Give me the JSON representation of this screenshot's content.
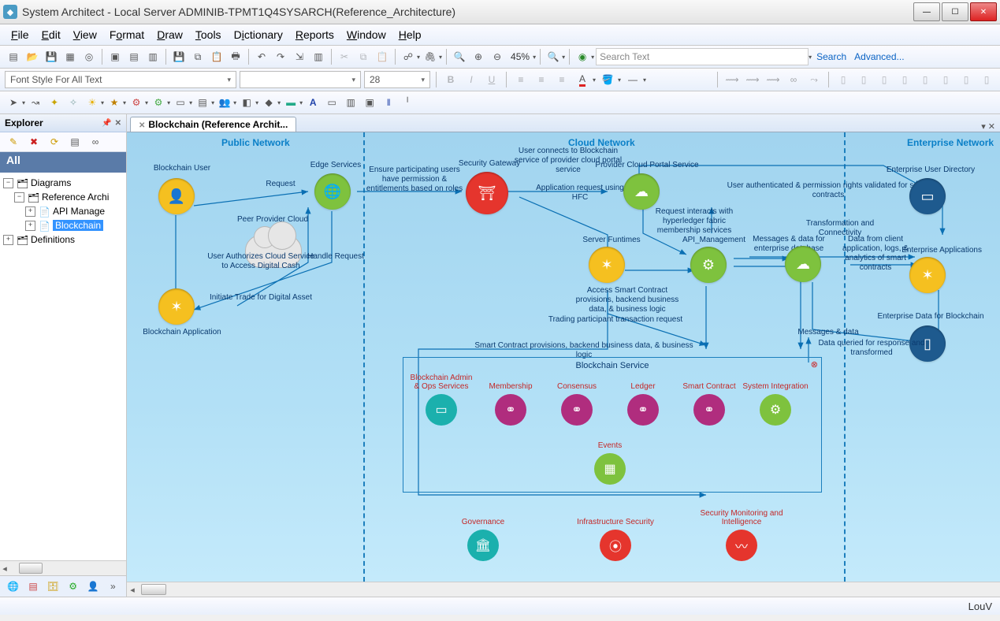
{
  "window": {
    "title": "System Architect - Local Server ADMINIB-TPMT1Q4SYSARCH(Reference_Architecture)"
  },
  "menubar": [
    "File",
    "Edit",
    "View",
    "Format",
    "Draw",
    "Tools",
    "Dictionary",
    "Reports",
    "Window",
    "Help"
  ],
  "toolbar": {
    "zoom": "45%",
    "search_placeholder": "Search Text",
    "search_link": "Search",
    "advanced_link": "Advanced..."
  },
  "format": {
    "font_style": "Font Style For All Text",
    "font_name": "",
    "font_size": "28"
  },
  "explorer": {
    "title": "Explorer",
    "all_label": "All",
    "nodes": {
      "diagrams": "Diagrams",
      "ref_arch": "Reference Archi",
      "api": "API Manage",
      "blockchain": "Blockchain",
      "definitions": "Definitions"
    }
  },
  "tab": {
    "title": "Blockchain (Reference Archit..."
  },
  "diagram": {
    "sections": {
      "public": "Public Network",
      "cloud": "Cloud Network",
      "enterprise": "Enterprise Network"
    },
    "nodes": {
      "blockchain_user": "Blockchain User",
      "edge_services": "Edge Services",
      "peer_cloud": "Peer Provider Cloud",
      "blockchain_app": "Blockchain Application",
      "security_gateway": "Security Gateway",
      "provider_portal": "Provider Cloud Portal Service",
      "server_runtimes": "Server Funtimes",
      "api_mgmt": "API_Management",
      "transform": "Transformation and Connectivity",
      "ent_user_dir": "Enterprise User Directory",
      "ent_apps": "Enterprise Applications",
      "ent_data": "Enterprise Data for Blockchain"
    },
    "edges": {
      "request": "Request",
      "handle_request": "Handle Request",
      "initiate_trade": "Initiate Trade for Digital Asset",
      "user_auth_cloud": "User Authorizes Cloud Service to Access Digital Cash",
      "ensure_perm": "Ensure participating users have permission & entitlements based on roles",
      "user_connects": "User connects to Blockchain service of provider cloud portal service",
      "app_req_hfc": "Application request using HFC",
      "req_hyperledger": "Request interacts with hyperledger fabric membership services",
      "msg_enterprise": "Messages & data for enterprise database",
      "user_auth_perm": "User authenticated & permission rights validated for smart contracts",
      "data_client": "Data from client application, logs, & analytics of smart contracts",
      "access_smart": "Access Smart Contract provisions, backend business data, & business logic",
      "trading_req": "Trading participant transaction request",
      "smart_contract_prov": "Smart Contract provisions, backend business data, & business logic",
      "msg_data": "Messages & data",
      "data_queried": "Data queried for response and transformed"
    },
    "service_box": {
      "title": "Blockchain Service",
      "items": [
        "Blockchain Admin & Ops Services",
        "Membership",
        "Consensus",
        "Ledger",
        "Smart Contract",
        "System Integration",
        "Events"
      ]
    },
    "bottom": [
      "Governance",
      "Infrastructure Security",
      "Security Monitoring and Intelligence"
    ]
  },
  "status": {
    "user": "LouV"
  }
}
